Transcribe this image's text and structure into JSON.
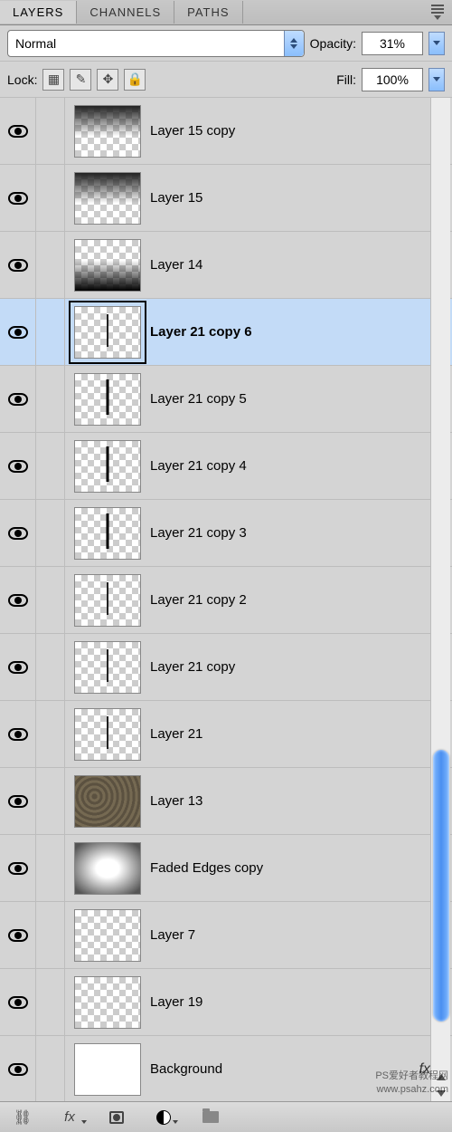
{
  "tabs": [
    "LAYERS",
    "CHANNELS",
    "PATHS"
  ],
  "active_tab": 0,
  "blend_mode": "Normal",
  "opacity_label": "Opacity:",
  "opacity_value": "31%",
  "lock_label": "Lock:",
  "fill_label": "Fill:",
  "fill_value": "100%",
  "layers": [
    {
      "name": "Layer 15 copy",
      "thumb": "gradient-top",
      "selected": false
    },
    {
      "name": "Layer 15",
      "thumb": "gradient-top",
      "selected": false
    },
    {
      "name": "Layer 14",
      "thumb": "gradient-bottom",
      "selected": false
    },
    {
      "name": "Layer 21 copy 6",
      "thumb": "line-thin",
      "selected": true
    },
    {
      "name": "Layer 21 copy 5",
      "thumb": "line",
      "selected": false
    },
    {
      "name": "Layer 21 copy 4",
      "thumb": "line",
      "selected": false
    },
    {
      "name": "Layer 21 copy 3",
      "thumb": "line",
      "selected": false
    },
    {
      "name": "Layer 21 copy 2",
      "thumb": "line-thin",
      "selected": false
    },
    {
      "name": "Layer 21 copy",
      "thumb": "line-thin",
      "selected": false
    },
    {
      "name": "Layer 21",
      "thumb": "line-thin",
      "selected": false
    },
    {
      "name": "Layer 13",
      "thumb": "texture",
      "selected": false
    },
    {
      "name": "Faded Edges copy",
      "thumb": "vignette",
      "selected": false
    },
    {
      "name": "Layer 7",
      "thumb": "checker",
      "selected": false
    },
    {
      "name": "Layer 19",
      "thumb": "checker",
      "selected": false
    },
    {
      "name": "Background",
      "thumb": "white",
      "selected": false,
      "fx": true
    }
  ],
  "fx_label": "fx",
  "watermark": {
    "line1": "PS爱好者教程网",
    "line2": "www.psahz.com"
  }
}
